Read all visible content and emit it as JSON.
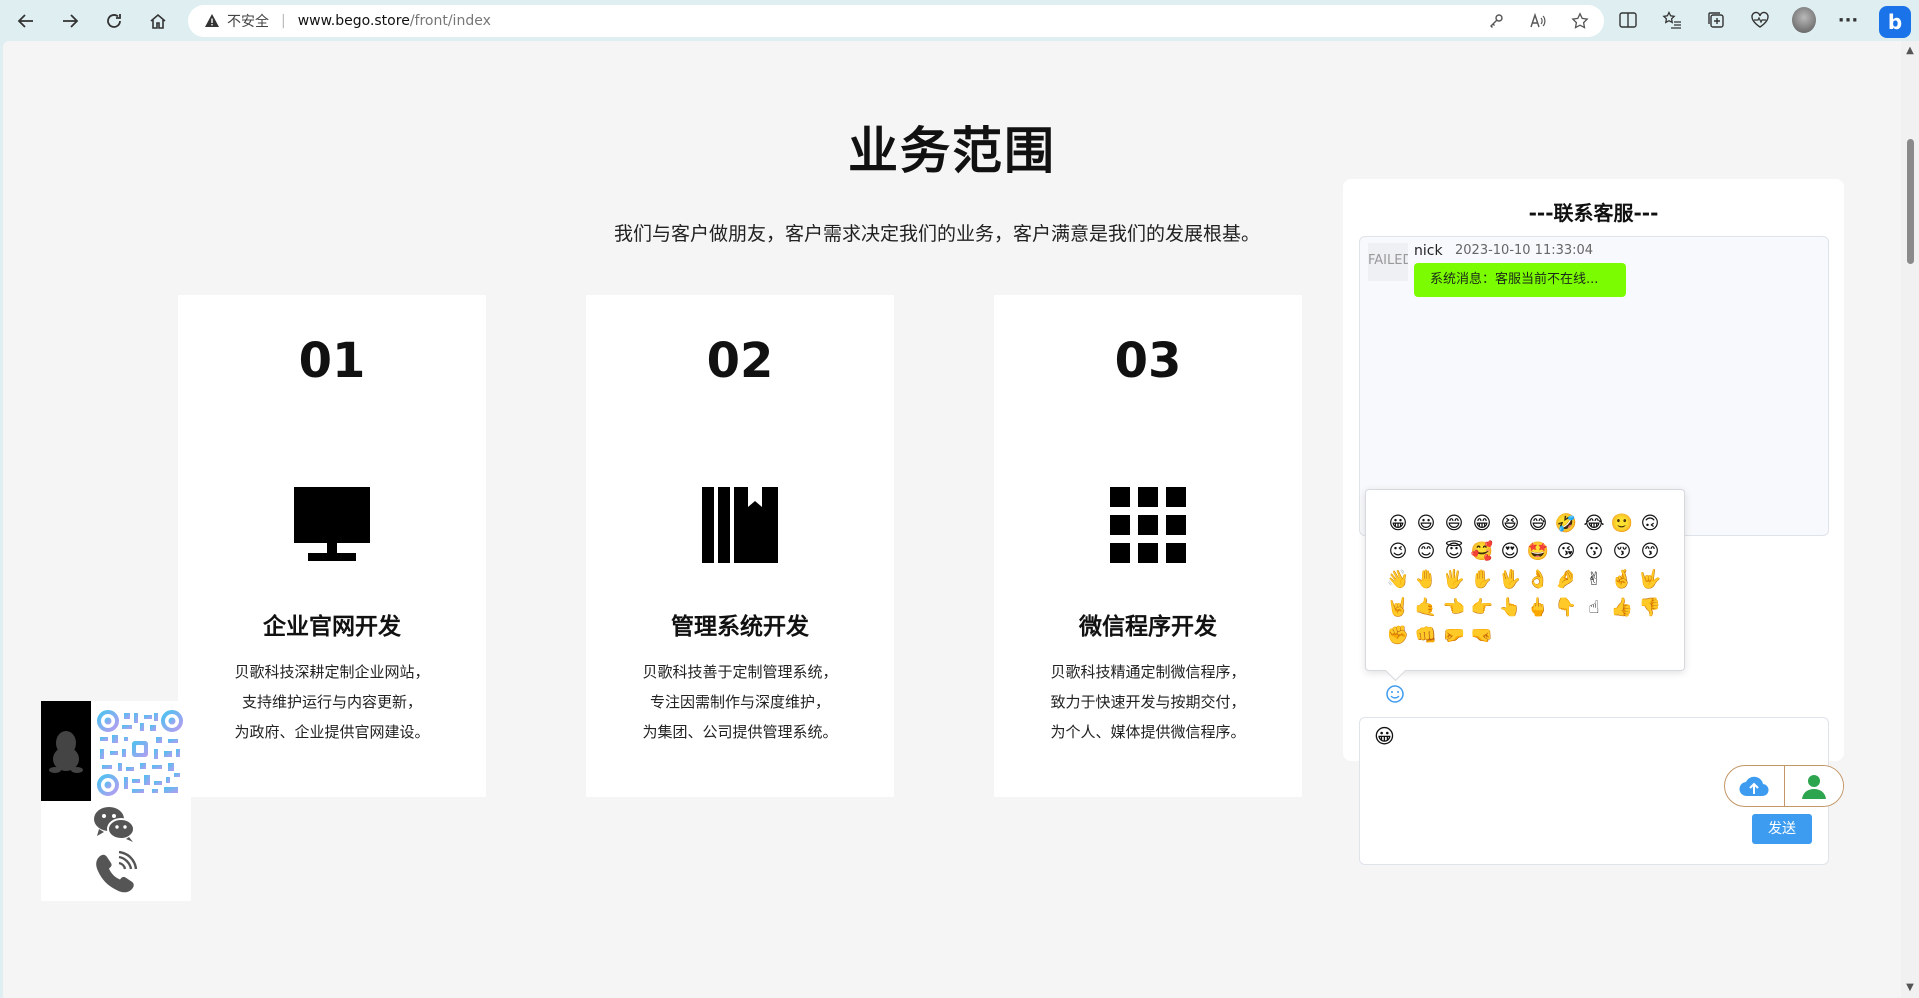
{
  "browser": {
    "insecure_label": "不安全",
    "url_host": "www.bego.store",
    "url_path": "/front/index"
  },
  "section": {
    "title": "业务范围",
    "subtitle": "我们与客户做朋友，客户需求决定我们的业务，客户满意是我们的发展根基。"
  },
  "cards": [
    {
      "number": "01",
      "icon": "monitor-icon",
      "title": "企业官网开发",
      "desc": [
        "贝歌科技深耕定制企业网站，",
        "支持维护运行与内容更新，",
        "为政府、企业提供官网建设。"
      ]
    },
    {
      "number": "02",
      "icon": "bookmark-book-icon",
      "title": "管理系统开发",
      "desc": [
        "贝歌科技善于定制管理系统，",
        "专注因需制作与深度维护，",
        "为集团、公司提供管理系统。"
      ]
    },
    {
      "number": "03",
      "icon": "grid-apps-icon",
      "title": "微信程序开发",
      "desc": [
        "贝歌科技精通定制微信程序，",
        "致力于快速开发与按期交付，",
        "为个人、媒体提供微信程序。"
      ]
    }
  ],
  "chat": {
    "title": "---联系客服---",
    "messages": [
      {
        "avatar_alt": "FAILED",
        "name": "nick",
        "time": "2023-10-10 11:33:04",
        "text": "系统消息：客服当前不在线..."
      }
    ],
    "emoji_rows": [
      [
        "😀",
        "😃",
        "😄",
        "😁",
        "😆",
        "😅",
        "🤣",
        "😂",
        "🙂",
        "🙃"
      ],
      [
        "😉",
        "😊",
        "😇",
        "🥰",
        "😍",
        "🤩",
        "😘",
        "😗",
        "😚",
        "😙"
      ],
      [
        "👋",
        "🤚",
        "🖐",
        "✋",
        "🖖",
        "👌",
        "🤌",
        "✌",
        "🤞",
        "🤟"
      ],
      [
        "🤘",
        "🤙",
        "👈",
        "👉",
        "👆",
        "🖕",
        "👇",
        "☝",
        "👍",
        "👎"
      ],
      [
        "✊",
        "👊",
        "🤛",
        "🤜"
      ]
    ],
    "input_value": "😀",
    "send_label": "发送"
  },
  "colors": {
    "accent_blue": "#3d9cf0",
    "bubble_green": "#7cfc00",
    "pill_border": "#c29666",
    "upload_blue": "#3d9cf0",
    "user_green": "#2da44e"
  }
}
